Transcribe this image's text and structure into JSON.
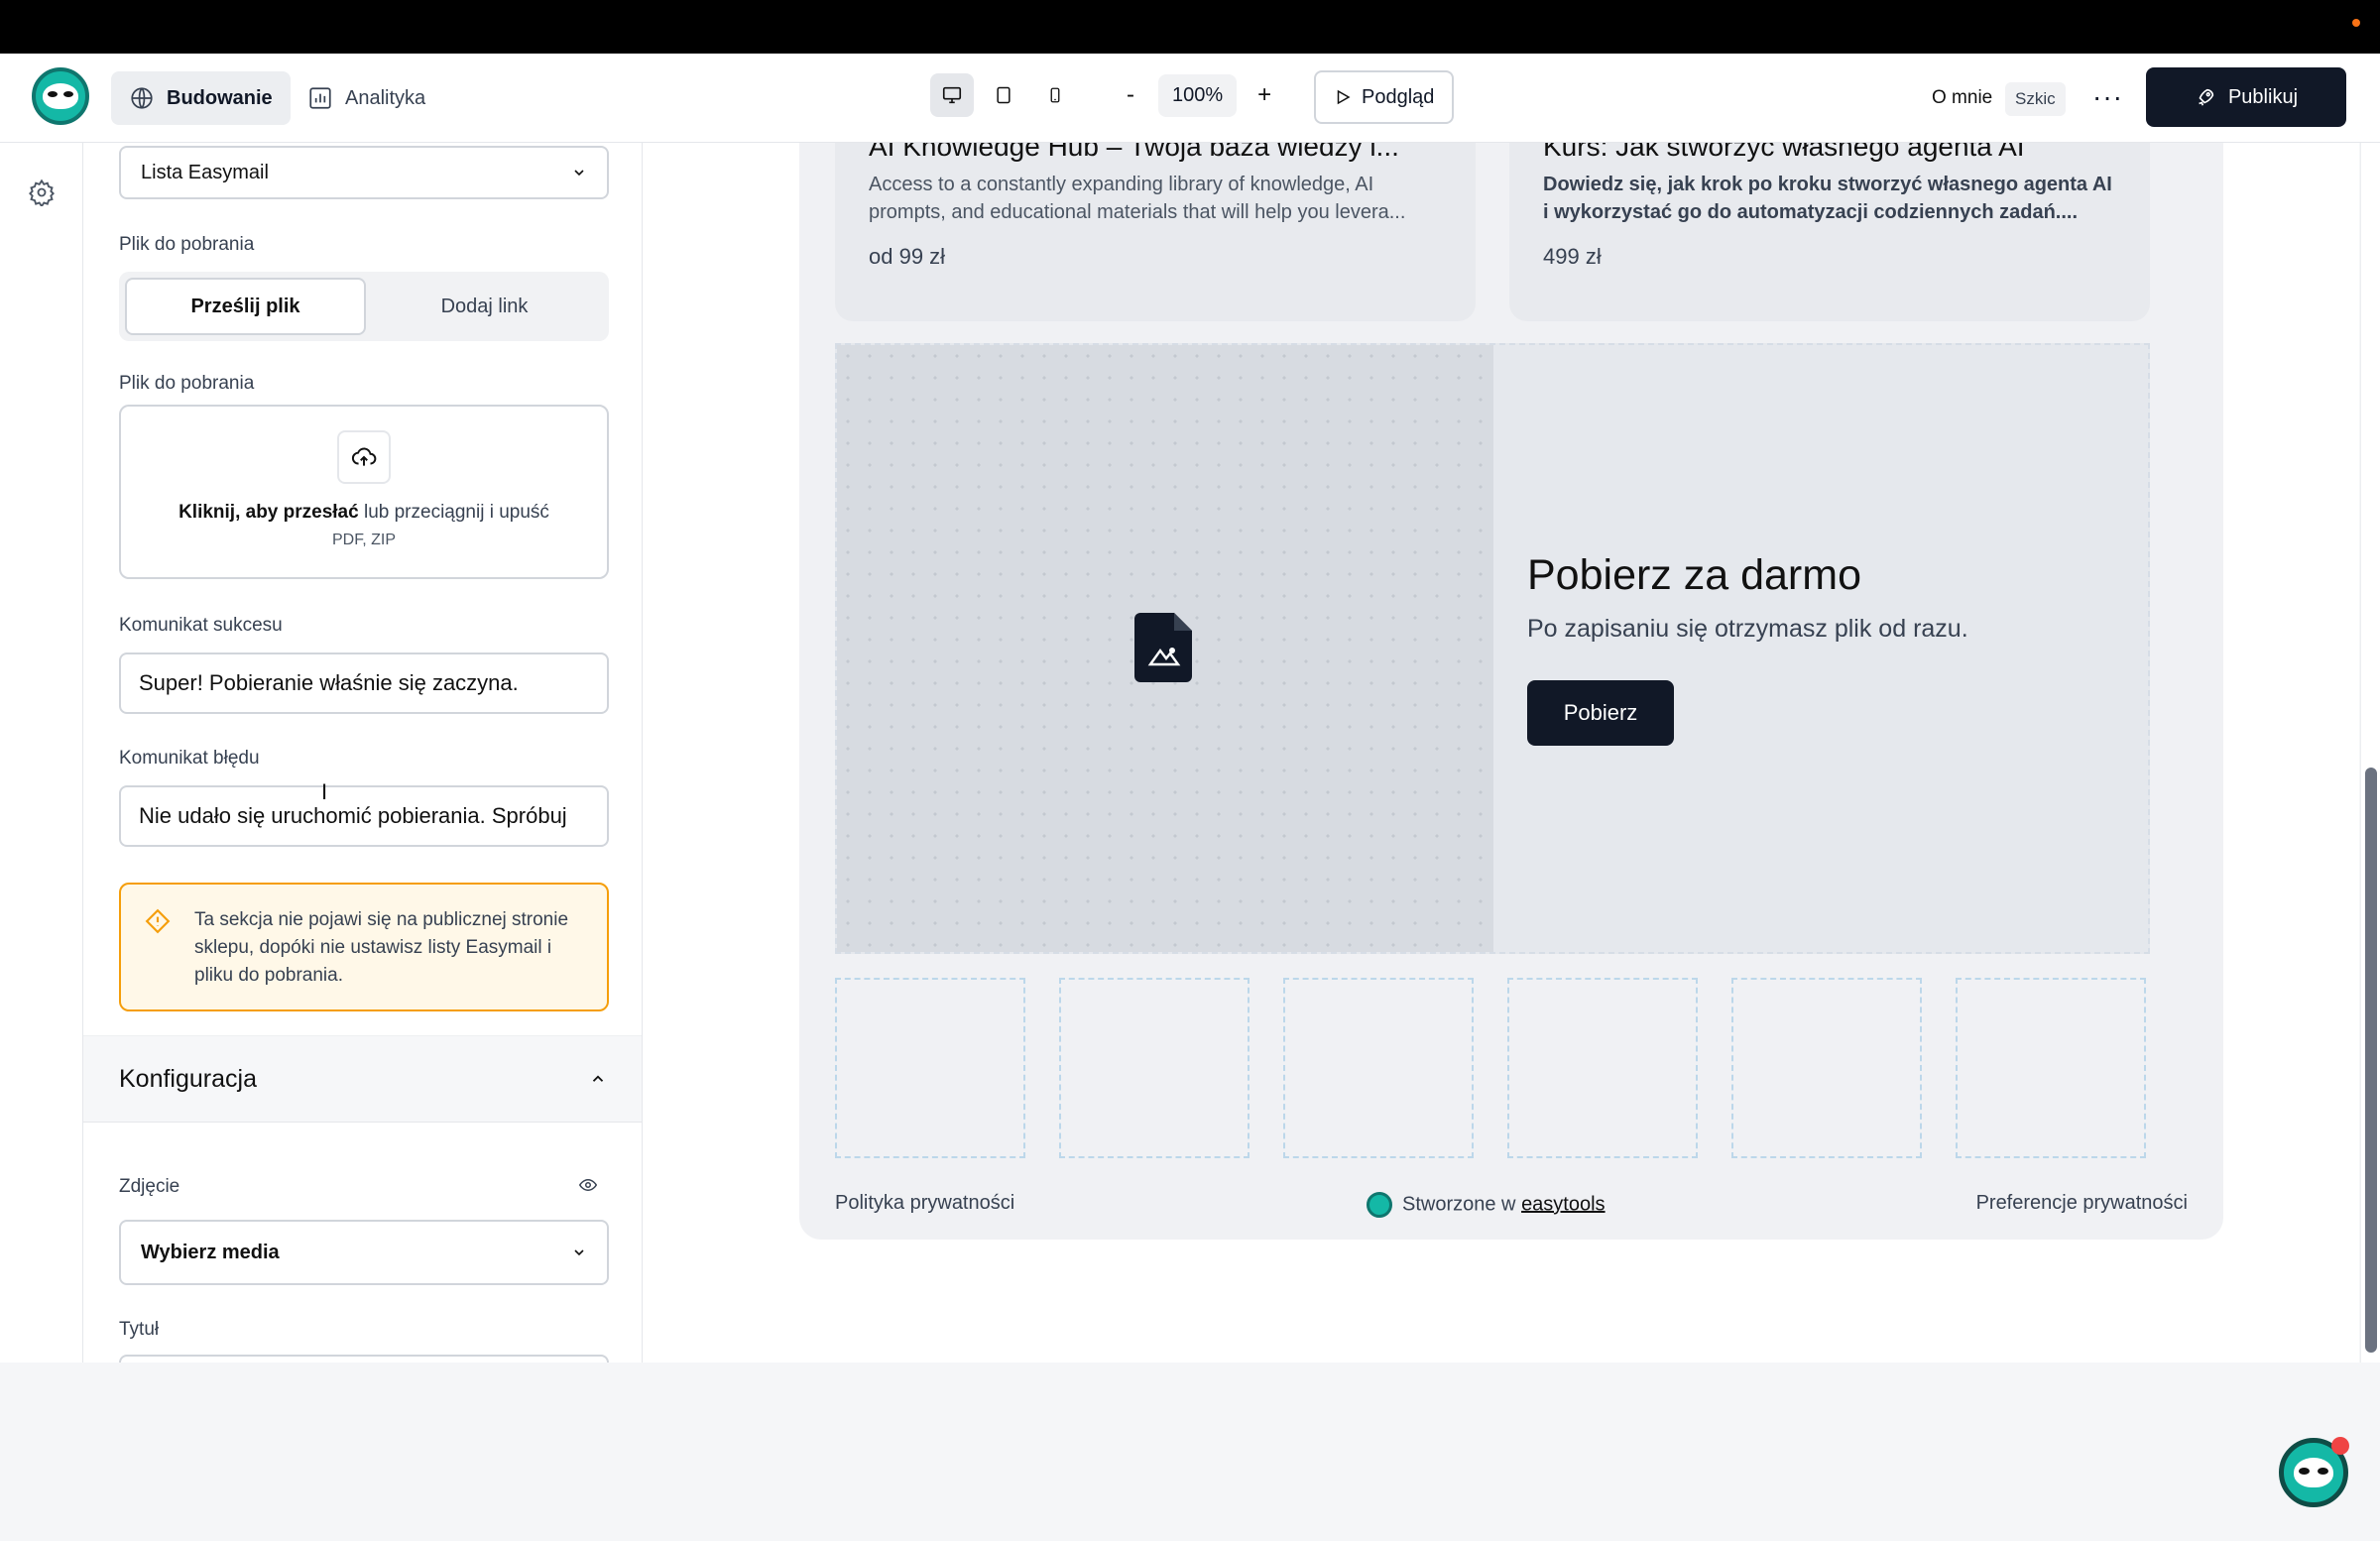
{
  "header": {
    "nav": [
      {
        "label": "Budowanie",
        "icon": "globe-icon"
      },
      {
        "label": "Analityka",
        "icon": "chart-icon"
      }
    ],
    "zoom": "100%",
    "zoom_minus": "-",
    "zoom_plus": "+",
    "preview_label": "Podgląd",
    "about_label": "O mnie",
    "draft_badge": "Szkic",
    "publish_label": "Publikuj"
  },
  "panel": {
    "list_select_value": "Lista Easymail",
    "file_label_1": "Plik do pobrania",
    "seg_upload": "Prześlij plik",
    "seg_link": "Dodaj link",
    "file_label_2": "Plik do pobrania",
    "upload_bold": "Kliknij, aby przesłać",
    "upload_rest": " lub przeciągnij i upuść",
    "upload_types": "PDF, ZIP",
    "success_label": "Komunikat sukcesu",
    "success_value": "Super! Pobieranie właśnie się zaczyna.",
    "error_label": "Komunikat błędu",
    "error_value": "Nie udało się uruchomić pobierania. Spróbuj",
    "warning": "Ta sekcja nie pojawi się na publicznej stronie sklepu, dopóki nie ustawisz listy Easymail i pliku do pobrania.",
    "config_title": "Konfiguracja",
    "photo_label": "Zdjęcie",
    "photo_select": "Wybierz media",
    "title_label": "Tytuł"
  },
  "canvas": {
    "cards": [
      {
        "title": "AI Knowledge Hub – Twoja baza wiedzy i...",
        "desc": "Access to a constantly expanding library of knowledge, AI prompts, and educational materials that will help you levera...",
        "price": "od 99 zł"
      },
      {
        "title": "Kurs: Jak stworzyć własnego agenta AI",
        "desc": "Dowiedz się, jak krok po kroku stworzyć własnego agenta AI i wykorzystać go do automatyzacji codziennych zadań....",
        "price": "499 zł"
      }
    ],
    "hero": {
      "title": "Pobierz za darmo",
      "subtitle": "Po zapisaniu się otrzymasz plik od razu.",
      "button": "Pobierz"
    },
    "footer": {
      "privacy": "Polityka prywatności",
      "made_with": "Stworzone w ",
      "brand": "easytools",
      "prefs": "Preferencje prywatności"
    }
  },
  "colors": {
    "accent": "#14b8a6",
    "dark": "#111827",
    "warning_border": "#f59e0b",
    "warning_bg": "#fff8e8"
  }
}
